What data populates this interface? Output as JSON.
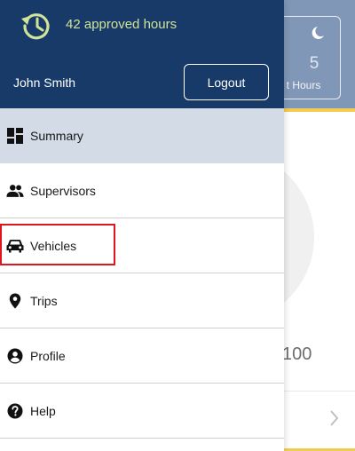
{
  "drawer": {
    "approved_hours": "42 approved hours",
    "user_name": "John Smith",
    "logout_label": "Logout",
    "menu": [
      {
        "label": "Summary",
        "icon": "dashboard-icon",
        "active": true
      },
      {
        "label": "Supervisors",
        "icon": "people-icon",
        "active": false
      },
      {
        "label": "Vehicles",
        "icon": "car-icon",
        "active": false,
        "highlighted": true
      },
      {
        "label": "Trips",
        "icon": "location-pin-icon",
        "active": false
      },
      {
        "label": "Profile",
        "icon": "account-circle-icon",
        "active": false
      },
      {
        "label": "Help",
        "icon": "help-icon",
        "active": false
      }
    ]
  },
  "background": {
    "card_value": "5",
    "card_label": "t Hours",
    "gauge_max": "100"
  },
  "colors": {
    "drawer_header": "#183a69",
    "hours_text": "#cfe39a",
    "active_item": "#d2dbe6",
    "highlight": "#e0141e",
    "accent_yellow": "#f2cc52"
  }
}
